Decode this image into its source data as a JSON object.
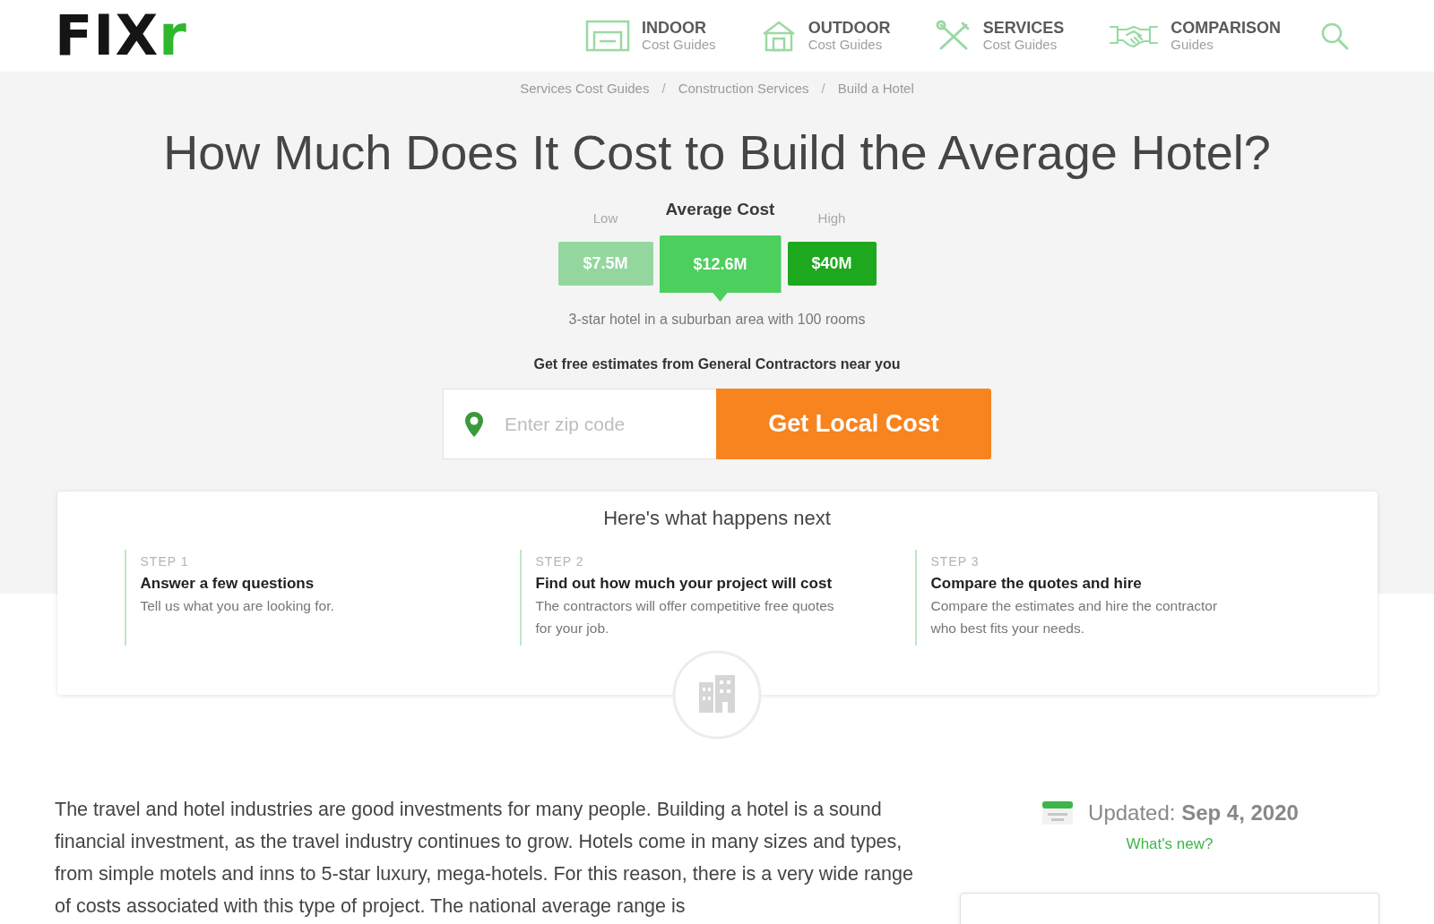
{
  "header": {
    "logo": {
      "text": "FIX",
      "accent": "r"
    },
    "nav": [
      {
        "kind": "indoor",
        "title": "INDOOR",
        "subtitle": "Cost Guides"
      },
      {
        "kind": "outdoor",
        "title": "OUTDOOR",
        "subtitle": "Cost Guides"
      },
      {
        "kind": "services",
        "title": "SERVICES",
        "subtitle": "Cost Guides"
      },
      {
        "kind": "comparison",
        "title": "COMPARISON",
        "subtitle": "Guides"
      }
    ]
  },
  "breadcrumb": {
    "separator": "/",
    "items": [
      "Services Cost Guides",
      "Construction Services",
      "Build a Hotel"
    ]
  },
  "title": "How Much Does It Cost to Build the Average Hotel?",
  "cost_range": {
    "items": [
      {
        "kind": "low",
        "label": "Low",
        "value": "$7.5M"
      },
      {
        "kind": "average",
        "label": "Average Cost",
        "value": "$12.6M"
      },
      {
        "kind": "high",
        "label": "High",
        "value": "$40M"
      }
    ],
    "caption": "3-star hotel in a suburban area with 100 rooms"
  },
  "estimate_form": {
    "prompt": "Get free estimates from General Contractors near you",
    "placeholder": "Enter zip code",
    "button": "Get Local Cost"
  },
  "next_steps": {
    "heading": "Here's what happens next",
    "steps": [
      {
        "step": "STEP 1",
        "title": "Answer a few questions",
        "text": "Tell us what you are looking for."
      },
      {
        "step": "STEP 2",
        "title": "Find out how much your project will cost",
        "text": "The contractors will offer competitive free quotes for your job."
      },
      {
        "step": "STEP 3",
        "title": "Compare the quotes and hire",
        "text": "Compare the estimates and hire the contractor who best fits your needs."
      }
    ]
  },
  "article": {
    "paragraph": "The travel and hotel industries are good investments for many people. Building a hotel is a sound financial investment, as the travel industry continues to grow. Hotels come in many sizes and types, from simple motels and inns to 5-star luxury, mega-hotels. For this reason, there is a very wide range of costs associated with this type of project. The national average range is"
  },
  "updated": {
    "text": "Updated: **Sep 4, 2020**",
    "link": "What's new?"
  }
}
